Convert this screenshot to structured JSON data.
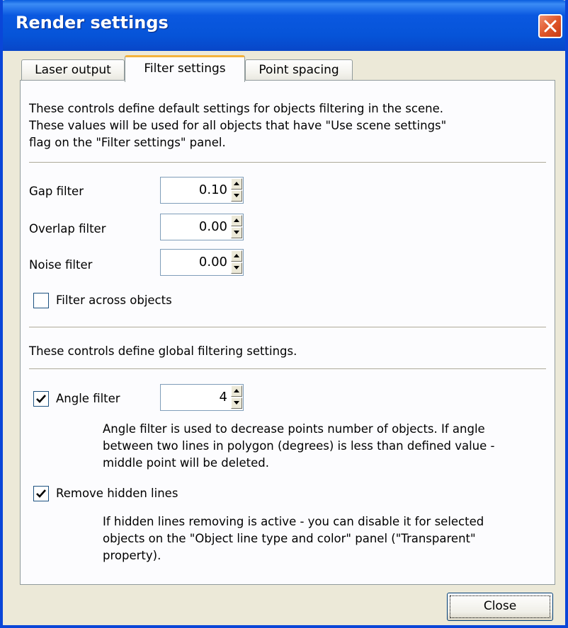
{
  "window": {
    "title": "Render settings"
  },
  "tabs": [
    {
      "label": "Laser output"
    },
    {
      "label": "Filter settings"
    },
    {
      "label": "Point spacing"
    }
  ],
  "scene_section": {
    "description": "These controls define default settings for objects filtering in the scene.\nThese values will be used for all objects that have \"Use scene settings\"\nflag on the \"Filter settings\" panel."
  },
  "fields": {
    "gap": {
      "label": "Gap filter",
      "value": "0.10"
    },
    "overlap": {
      "label": "Overlap filter",
      "value": "0.00"
    },
    "noise": {
      "label": "Noise filter",
      "value": "0.00"
    }
  },
  "filter_across": {
    "label": "Filter across objects",
    "checked": false
  },
  "global_section": {
    "description": "These controls define global filtering settings."
  },
  "angle_filter": {
    "label": "Angle filter",
    "checked": true,
    "value": "4",
    "description": "Angle filter is used to decrease points number of objects. If angle\nbetween two lines in polygon (degrees) is less than defined value -\nmiddle point will be deleted."
  },
  "remove_hidden": {
    "label": "Remove hidden lines",
    "checked": true,
    "description": "If hidden lines removing is active - you can disable it for selected\nobjects on the \"Object line type and color\" panel (\"Transparent\"\nproperty)."
  },
  "footer": {
    "close_label": "Close"
  }
}
